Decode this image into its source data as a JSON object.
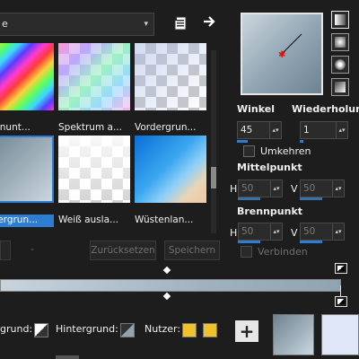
{
  "top": {
    "dropdown_value": "e",
    "dropdown_arrow": "▾",
    "preset_icon": "document-list-icon",
    "arrow_icon": "→"
  },
  "presets": [
    {
      "label": "nnenunt..."
    },
    {
      "label": "Spektrum a..."
    },
    {
      "label": "Vordergrun..."
    },
    {
      "label": "ordergrun...",
      "selected": true
    },
    {
      "label": "Weiß ausla..."
    },
    {
      "label": "Wüstenlan..."
    }
  ],
  "buttons": {
    "left": "",
    "minus": "-",
    "reset": "Zurücksetzen",
    "save": "Speichern"
  },
  "right": {
    "winkel_label": "Winkel",
    "wiederholung_label": "Wiederholung",
    "winkel_value": "45",
    "wiederholung_value": "1",
    "umkehren_label": "Umkehren",
    "mittelpunkt_label": "Mittelpunkt",
    "brennpunkt_label": "Brennpunkt",
    "h_label": "H",
    "v_label": "V",
    "mitte_h": "50",
    "mitte_v": "50",
    "brenn_h": "50",
    "brenn_v": "50",
    "verbinden_label": "Verbinden"
  },
  "bottom": {
    "vordergrund_label": "grund:",
    "hintergrund_label": "Hintergrund:",
    "nutzer_label": "Nutzer:",
    "add_label": "+"
  },
  "colors": {
    "accent": "#2d7dd2",
    "user1": "#f2c22b",
    "user2": "#f2c22b",
    "fg_swatch": "#9fb2bf",
    "bg_swatch": "#dfe6f8"
  }
}
